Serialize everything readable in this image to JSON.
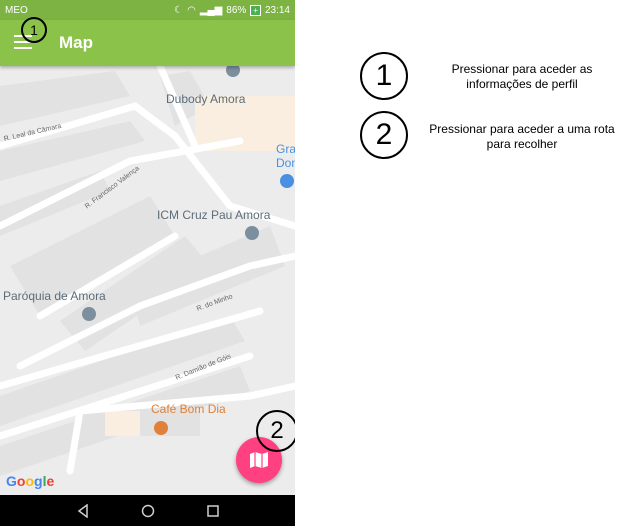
{
  "statusbar": {
    "carrier": "MEO",
    "battery": "86%",
    "time": "23:14"
  },
  "appbar": {
    "title": "Map",
    "callout_number": "1"
  },
  "map": {
    "places": {
      "dubody": "Dubody Amora",
      "gran1": "Gra",
      "gran2": "Don",
      "icm": "ICM Cruz Pau Amora",
      "paroquia": "Paróquia de Amora",
      "cafe": "Café Bom Dia"
    },
    "streets": {
      "leal": "R. Leal da Câmara",
      "francisco": "R. Francisco Valença",
      "minho": "R. do Minho",
      "damiao": "R. Damião de Góis"
    },
    "google": [
      "G",
      "o",
      "o",
      "g",
      "l",
      "e"
    ],
    "google_colors": [
      "#4285F4",
      "#EA4335",
      "#FBBC05",
      "#4285F4",
      "#34A853",
      "#EA4335"
    ]
  },
  "fab": {
    "callout_number": "2"
  },
  "legend": [
    {
      "number": "1",
      "text_line1": "Pressionar para aceder as",
      "text_line2": "informações de perfil"
    },
    {
      "number": "2",
      "text_line1": "Pressionar para aceder a uma rota",
      "text_line2": "para recolher"
    }
  ]
}
